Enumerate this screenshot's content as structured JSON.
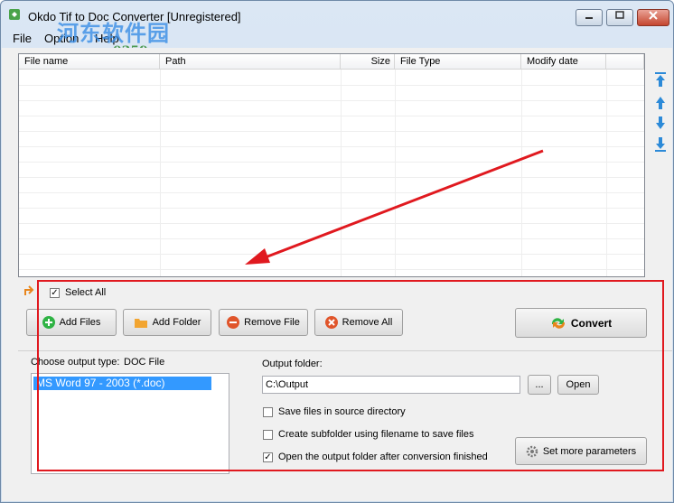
{
  "window": {
    "title": "Okdo Tif to Doc Converter [Unregistered]"
  },
  "menu": [
    "File",
    "Option",
    "Help"
  ],
  "watermark": {
    "text": "河东软件园",
    "url": "www.pc0359.cn"
  },
  "file_list": {
    "columns": [
      "File name",
      "Path",
      "Size",
      "File Type",
      "Modify date"
    ],
    "rows": []
  },
  "select_all": {
    "label": "Select All",
    "checked": true
  },
  "buttons": {
    "add_files": "Add Files",
    "add_folder": "Add Folder",
    "remove_file": "Remove File",
    "remove_all": "Remove All",
    "convert": "Convert",
    "browse": "...",
    "open": "Open",
    "set_more_parameters": "Set more parameters"
  },
  "output_type": {
    "label": "Choose output type:",
    "value": "DOC File",
    "options": [
      "MS Word 97 - 2003 (*.doc)"
    ]
  },
  "output_folder": {
    "label": "Output folder:",
    "value": "C:\\Output"
  },
  "options": {
    "save_in_source": {
      "label": "Save files in source directory",
      "checked": false
    },
    "create_subfolder": {
      "label": "Create subfolder using filename to save files",
      "checked": false
    },
    "open_after": {
      "label": "Open the output folder after conversion finished",
      "checked": true
    }
  },
  "colors": {
    "annotation_red": "#e0191f",
    "selection_blue": "#3399ff",
    "arrow_blue": "#2c8ad8"
  }
}
